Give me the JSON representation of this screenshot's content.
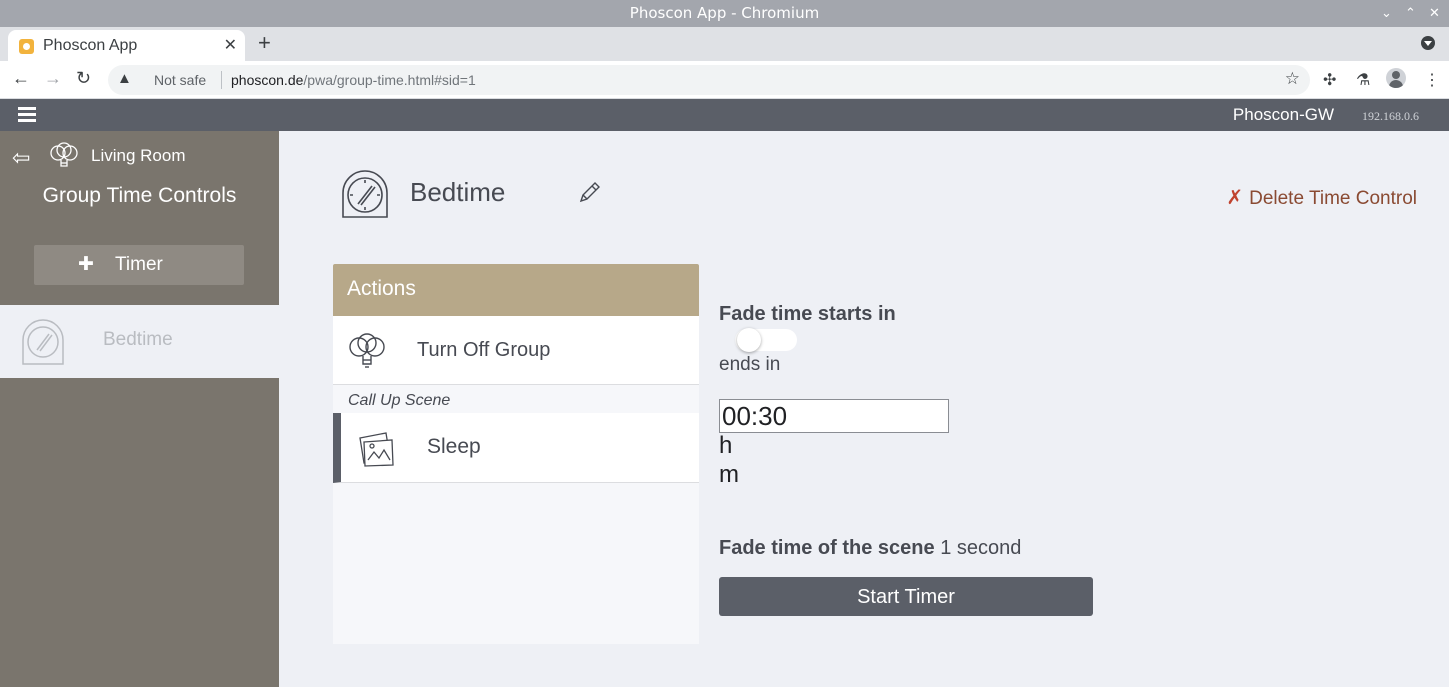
{
  "window": {
    "title": "Phoscon App - Chromium"
  },
  "browser": {
    "tab_title": "Phoscon App",
    "not_safe_label": "Not safe",
    "url_host": "phoscon.de",
    "url_path": "/pwa/group-time.html#sid=1"
  },
  "header": {
    "gateway_name": "Phoscon-GW",
    "gateway_ip": "192.168.0.6"
  },
  "sidebar": {
    "room": "Living Room",
    "title": "Group Time Controls",
    "add_label": "Timer",
    "items": [
      {
        "label": "Bedtime"
      }
    ]
  },
  "main": {
    "title": "Bedtime",
    "delete_label": "Delete Time Control",
    "actions": {
      "heading": "Actions",
      "turn_off_label": "Turn Off Group",
      "section_label": "Call Up Scene",
      "scene_label": "Sleep"
    },
    "fade": {
      "heading": "Fade time starts in",
      "ends_label": "ends in",
      "time_value": "00:30",
      "unit_h": "h",
      "unit_m": "m",
      "scene_fade_label": "Fade time of the scene",
      "scene_fade_value": "1 second",
      "toggle_on": false
    },
    "start_label": "Start Timer"
  },
  "colors": {
    "sidebar": "#7a756d",
    "appbar": "#5b5f68",
    "actions_header": "#b7a889",
    "delete_accent": "#c0432f"
  }
}
